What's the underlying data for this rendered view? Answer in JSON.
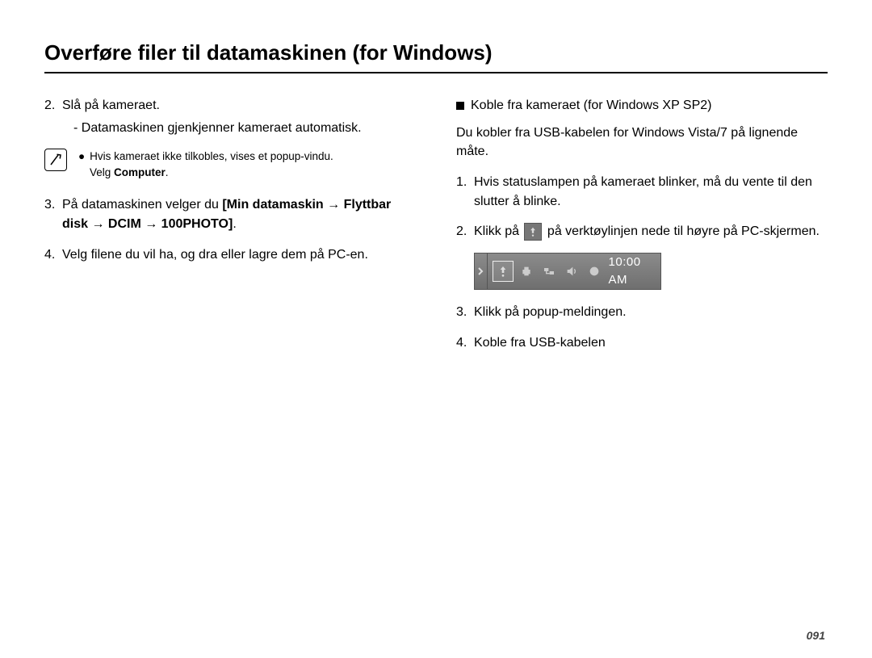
{
  "title": "Overføre filer til datamaskinen (for Windows)",
  "left": {
    "step2_num": "2.",
    "step2_text": "Slå på kameraet.",
    "step2_sub": "- Datamaskinen gjenkjenner kameraet automatisk.",
    "note_bullet": "●",
    "note_line1": "Hvis kameraet ikke tilkobles, vises et popup-vindu.",
    "note_line2_pre": "Velg ",
    "note_line2_bold": "Computer",
    "note_line2_post": ".",
    "step3_num": "3.",
    "step3_pre": "På datamaskinen velger du ",
    "step3_bold": "[Min datamaskin → Flyttbar disk → DCIM → 100PHOTO]",
    "step3_post": ".",
    "step4_num": "4.",
    "step4_text": "Velg filene du vil ha, og dra eller lagre dem på PC-en."
  },
  "right": {
    "subheading": "Koble fra kameraet (for Windows XP SP2)",
    "para1": "Du kobler fra USB-kabelen for Windows Vista/7 på lignende måte.",
    "r1_num": "1.",
    "r1_text": "Hvis statuslampen på kameraet blinker, må du vente til den slutter å blinke.",
    "r2_num": "2.",
    "r2_pre": "Klikk på ",
    "r2_post": " på verktøylinjen nede til høyre på PC-skjermen.",
    "tray_time": "10:00 AM",
    "r3_num": "3.",
    "r3_text": "Klikk på popup-meldingen.",
    "r4_num": "4.",
    "r4_text": "Koble fra USB-kabelen"
  },
  "pagenum": "091"
}
